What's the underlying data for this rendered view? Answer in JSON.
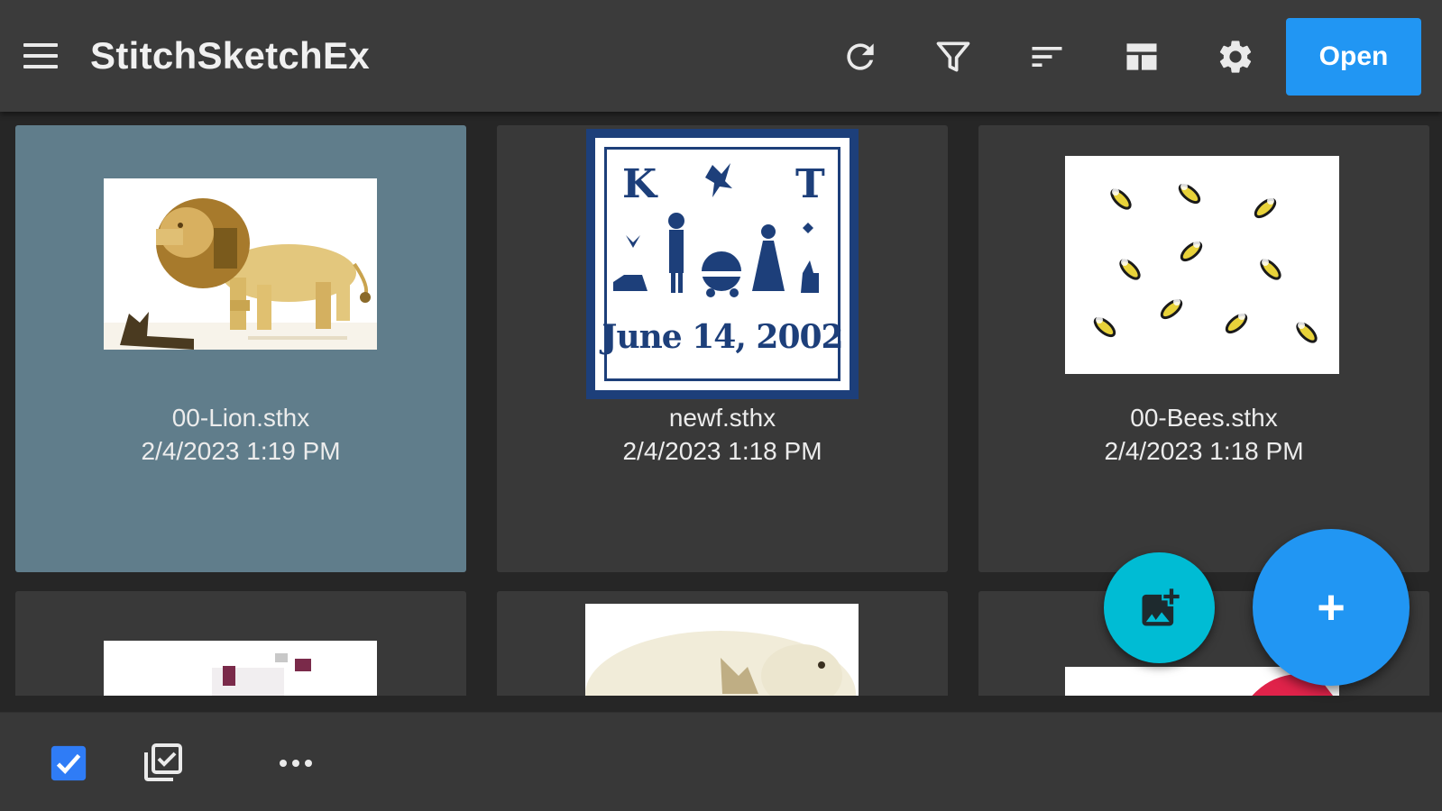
{
  "app": {
    "title": "StitchSketchEx"
  },
  "toolbar": {
    "open_label": "Open",
    "icons": [
      "refresh-icon",
      "filter-icon",
      "sort-icon",
      "layout-icon",
      "settings-icon"
    ]
  },
  "files": [
    {
      "name": "00-Lion.sthx",
      "date": "2/4/2023 1:19 PM",
      "selected": true
    },
    {
      "name": "newf.sthx",
      "date": "2/4/2023 1:18 PM",
      "selected": false
    },
    {
      "name": "00-Bees.sthx",
      "date": "2/4/2023 1:18 PM",
      "selected": false
    }
  ],
  "sampler": {
    "letters": [
      "K",
      "T"
    ],
    "date_text": "June 14, 2002"
  },
  "bottom": {
    "icons": [
      "select-checkbox-icon",
      "select-all-icon",
      "more-icon"
    ]
  },
  "fab": {
    "add_label": "+"
  },
  "colors": {
    "accent": "#2196f3",
    "fab_secondary": "#00bcd4",
    "selected_card": "#607d8b",
    "card": "#393939",
    "appbar": "#3b3b3b",
    "sampler_blue": "#1d3f7a"
  }
}
